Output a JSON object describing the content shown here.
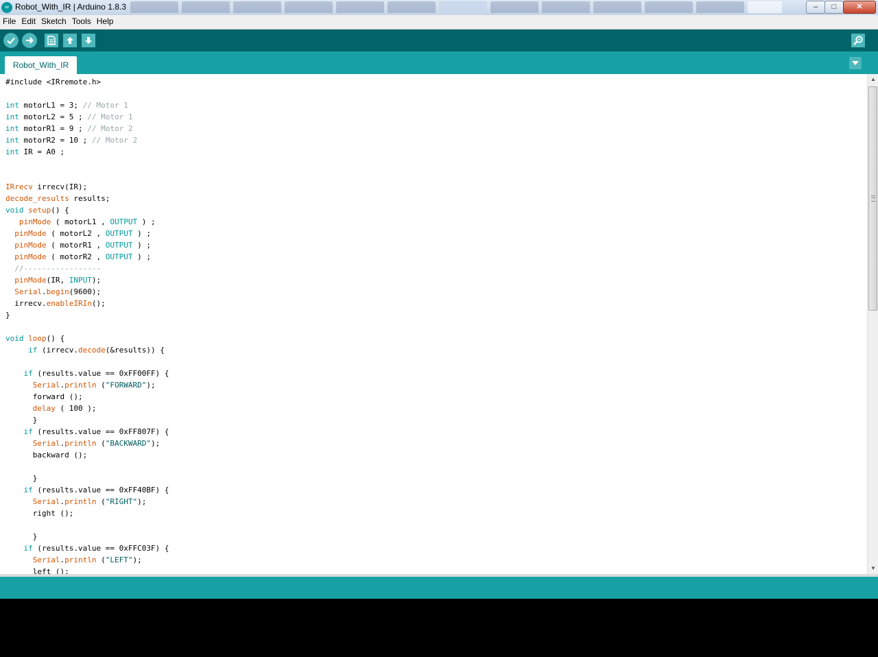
{
  "window": {
    "title": "Robot_With_IR | Arduino 1.8.3",
    "icon": "arduino-logo-icon",
    "controls": {
      "minimize": "‒",
      "maximize": "□",
      "close": "✕"
    }
  },
  "menu": {
    "items": [
      {
        "label": "File"
      },
      {
        "label": "Edit"
      },
      {
        "label": "Sketch"
      },
      {
        "label": "Tools"
      },
      {
        "label": "Help"
      }
    ]
  },
  "toolbar": {
    "buttons": [
      "verify-icon",
      "upload-icon",
      "new-icon",
      "open-icon",
      "save-icon"
    ],
    "serial_monitor": "magnifier-icon"
  },
  "tabs": [
    {
      "label": "Robot_With_IR",
      "active": true
    }
  ],
  "editor": {
    "lines": [
      [
        [
          "pp",
          "#include <IRremote.h>"
        ]
      ],
      [],
      [
        [
          "kw",
          "int"
        ],
        [
          "tx",
          " motorL1 = 3; "
        ],
        [
          "cm",
          "// Motor 1"
        ]
      ],
      [
        [
          "kw",
          "int"
        ],
        [
          "tx",
          " motorL2 = 5 ; "
        ],
        [
          "cm",
          "// Motor 1"
        ]
      ],
      [
        [
          "kw",
          "int"
        ],
        [
          "tx",
          " motorR1 = 9 ; "
        ],
        [
          "cm",
          "// Motor 2"
        ]
      ],
      [
        [
          "kw",
          "int"
        ],
        [
          "tx",
          " motorR2 = 10 ; "
        ],
        [
          "cm",
          "// Motor 2"
        ]
      ],
      [
        [
          "kw",
          "int"
        ],
        [
          "tx",
          " IR = A0 ;"
        ]
      ],
      [],
      [],
      [
        [
          "fn",
          "IRrecv"
        ],
        [
          "tx",
          " irrecv(IR);"
        ]
      ],
      [
        [
          "fn",
          "decode_results"
        ],
        [
          "tx",
          " results;"
        ]
      ],
      [
        [
          "kw",
          "void"
        ],
        [
          "tx",
          " "
        ],
        [
          "fn",
          "setup"
        ],
        [
          "tx",
          "() {"
        ]
      ],
      [
        [
          "tx",
          "   "
        ],
        [
          "fn",
          "pinMode"
        ],
        [
          "tx",
          " ( motorL1 , "
        ],
        [
          "cn",
          "OUTPUT"
        ],
        [
          "tx",
          " ) ;"
        ]
      ],
      [
        [
          "tx",
          "  "
        ],
        [
          "fn",
          "pinMode"
        ],
        [
          "tx",
          " ( motorL2 , "
        ],
        [
          "cn",
          "OUTPUT"
        ],
        [
          "tx",
          " ) ;"
        ]
      ],
      [
        [
          "tx",
          "  "
        ],
        [
          "fn",
          "pinMode"
        ],
        [
          "tx",
          " ( motorR1 , "
        ],
        [
          "cn",
          "OUTPUT"
        ],
        [
          "tx",
          " ) ;"
        ]
      ],
      [
        [
          "tx",
          "  "
        ],
        [
          "fn",
          "pinMode"
        ],
        [
          "tx",
          " ( motorR2 , "
        ],
        [
          "cn",
          "OUTPUT"
        ],
        [
          "tx",
          " ) ;"
        ]
      ],
      [
        [
          "tx",
          "  "
        ],
        [
          "cm",
          "//-----------------"
        ]
      ],
      [
        [
          "tx",
          "  "
        ],
        [
          "fn",
          "pinMode"
        ],
        [
          "tx",
          "(IR, "
        ],
        [
          "cn",
          "INPUT"
        ],
        [
          "tx",
          ");"
        ]
      ],
      [
        [
          "tx",
          "  "
        ],
        [
          "fn",
          "Serial"
        ],
        [
          "tx",
          "."
        ],
        [
          "fn",
          "begin"
        ],
        [
          "tx",
          "(9600);"
        ]
      ],
      [
        [
          "tx",
          "  irrecv."
        ],
        [
          "fn",
          "enableIRIn"
        ],
        [
          "tx",
          "();"
        ]
      ],
      [
        [
          "tx",
          "}"
        ]
      ],
      [],
      [
        [
          "kw",
          "void"
        ],
        [
          "tx",
          " "
        ],
        [
          "fn",
          "loop"
        ],
        [
          "tx",
          "() {"
        ]
      ],
      [
        [
          "tx",
          "     "
        ],
        [
          "kw",
          "if"
        ],
        [
          "tx",
          " (irrecv."
        ],
        [
          "fn",
          "decode"
        ],
        [
          "tx",
          "(&results)) {"
        ]
      ],
      [],
      [
        [
          "tx",
          "    "
        ],
        [
          "kw",
          "if"
        ],
        [
          "tx",
          " (results.value == 0xFF00FF) {"
        ]
      ],
      [
        [
          "tx",
          "      "
        ],
        [
          "fn",
          "Serial"
        ],
        [
          "tx",
          "."
        ],
        [
          "fn",
          "println"
        ],
        [
          "tx",
          " ("
        ],
        [
          "st",
          "\"FORWARD\""
        ],
        [
          "tx",
          ");"
        ]
      ],
      [
        [
          "tx",
          "      forward ();"
        ]
      ],
      [
        [
          "tx",
          "      "
        ],
        [
          "fn",
          "delay"
        ],
        [
          "tx",
          " ( 100 );"
        ]
      ],
      [
        [
          "tx",
          "      }"
        ]
      ],
      [
        [
          "tx",
          "    "
        ],
        [
          "kw",
          "if"
        ],
        [
          "tx",
          " (results.value == 0xFF807F) {"
        ]
      ],
      [
        [
          "tx",
          "      "
        ],
        [
          "fn",
          "Serial"
        ],
        [
          "tx",
          "."
        ],
        [
          "fn",
          "println"
        ],
        [
          "tx",
          " ("
        ],
        [
          "st",
          "\"BACKWARD\""
        ],
        [
          "tx",
          ");"
        ]
      ],
      [
        [
          "tx",
          "      backward ();"
        ]
      ],
      [],
      [
        [
          "tx",
          "      }"
        ]
      ],
      [
        [
          "tx",
          "    "
        ],
        [
          "kw",
          "if"
        ],
        [
          "tx",
          " (results.value == 0xFF40BF) {"
        ]
      ],
      [
        [
          "tx",
          "      "
        ],
        [
          "fn",
          "Serial"
        ],
        [
          "tx",
          "."
        ],
        [
          "fn",
          "println"
        ],
        [
          "tx",
          " ("
        ],
        [
          "st",
          "\"RIGHT\""
        ],
        [
          "tx",
          ");"
        ]
      ],
      [
        [
          "tx",
          "      right ();"
        ]
      ],
      [],
      [
        [
          "tx",
          "      }"
        ]
      ],
      [
        [
          "tx",
          "    "
        ],
        [
          "kw",
          "if"
        ],
        [
          "tx",
          " (results.value == 0xFFC03F) {"
        ]
      ],
      [
        [
          "tx",
          "      "
        ],
        [
          "fn",
          "Serial"
        ],
        [
          "tx",
          "."
        ],
        [
          "fn",
          "println"
        ],
        [
          "tx",
          " ("
        ],
        [
          "st",
          "\"LEFT\""
        ],
        [
          "tx",
          ");"
        ]
      ],
      [
        [
          "tx",
          "      left ();"
        ]
      ]
    ]
  },
  "colors": {
    "toolbar": "#006468",
    "tabbar": "#17a1a5",
    "button": "#4db7bb",
    "keyword": "#00979c",
    "function": "#d35400",
    "comment": "#95a5a6"
  }
}
